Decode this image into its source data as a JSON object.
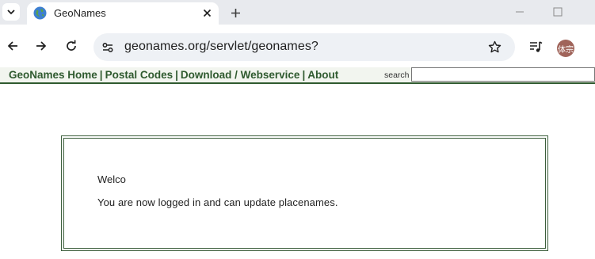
{
  "tabs": [
    {
      "title": "GeoNames"
    }
  ],
  "icons": {
    "tab_menu": "chevron-down-icon",
    "favicon": "globe-icon",
    "tab_close": "close-icon",
    "new_tab": "plus-icon",
    "minimize": "minimize-icon",
    "maximize": "maximize-icon",
    "back": "arrow-left-icon",
    "forward": "arrow-right-icon",
    "reload": "reload-icon",
    "site_info": "tune-icon",
    "bookmark": "star-icon",
    "media": "queue-music-icon"
  },
  "address_bar": {
    "url": "geonames.org/servlet/geonames?"
  },
  "profile": {
    "avatar_text": "体宗"
  },
  "site_nav": {
    "links": [
      "GeoNames Home",
      "Postal Codes",
      "Download / Webservice",
      "About"
    ],
    "separator": "|",
    "search_label": "search",
    "search_value": ""
  },
  "content": {
    "welcome": "Welco",
    "message": "You are now logged in and can update placenames."
  },
  "colors": {
    "brand_green": "#2f5a2f",
    "tabstrip_bg": "#e8eaee",
    "omnibox_bg": "#eef1f5",
    "avatar_bg": "#a0645a"
  }
}
